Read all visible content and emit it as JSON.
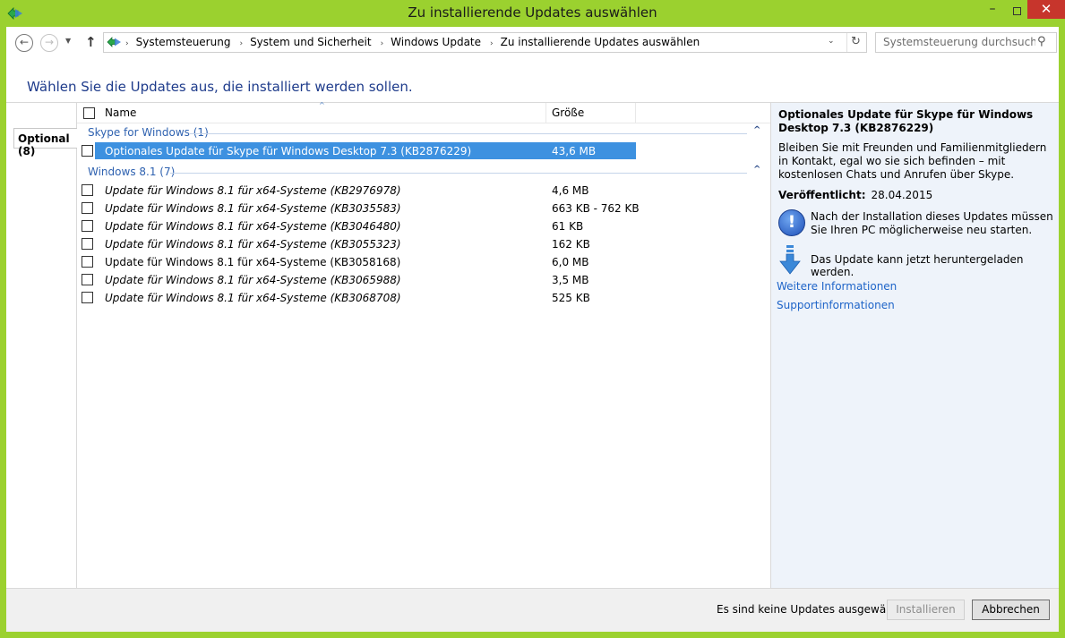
{
  "window": {
    "title": "Zu installierende Updates auswählen",
    "minimize": "–",
    "close": "✕"
  },
  "nav": {
    "back": "←",
    "forward": "→",
    "dropdown": "▼",
    "up": "↑",
    "breadcrumbs": [
      "Systemsteuerung",
      "System und Sicherheit",
      "Windows Update",
      "Zu installierende Updates auswählen"
    ],
    "breadcrumb_separator": "›",
    "search_placeholder": "Systemsteuerung durchsuchen"
  },
  "heading": "Wählen Sie die Updates aus, die installiert werden sollen.",
  "tabs": {
    "optional": "Optional (8)"
  },
  "columns": {
    "name": "Name",
    "size": "Größe"
  },
  "groups": [
    {
      "label": "Skype for Windows (1)",
      "items": [
        {
          "name": "Optionales Update für Skype für Windows Desktop 7.3 (KB2876229)",
          "size": "43,6 MB",
          "selected": true,
          "italic": false
        }
      ]
    },
    {
      "label": "Windows 8.1 (7)",
      "items": [
        {
          "name": "Update für Windows 8.1 für x64-Systeme (KB2976978)",
          "size": "4,6 MB",
          "italic": true
        },
        {
          "name": "Update für Windows 8.1 für x64-Systeme (KB3035583)",
          "size": "663 KB - 762 KB",
          "italic": true
        },
        {
          "name": "Update für Windows 8.1 für x64-Systeme (KB3046480)",
          "size": "61 KB",
          "italic": true
        },
        {
          "name": "Update für Windows 8.1 für x64-Systeme (KB3055323)",
          "size": "162 KB",
          "italic": true
        },
        {
          "name": "Update für Windows 8.1 für x64-Systeme (KB3058168)",
          "size": "6,0 MB",
          "italic": false
        },
        {
          "name": "Update für Windows 8.1 für x64-Systeme (KB3065988)",
          "size": "3,5 MB",
          "italic": true
        },
        {
          "name": "Update für Windows 8.1 für x64-Systeme (KB3068708)",
          "size": "525 KB",
          "italic": true
        }
      ]
    }
  ],
  "details": {
    "title": "Optionales Update für Skype für Windows Desktop 7.3 (KB2876229)",
    "description": "Bleiben Sie mit Freunden und Familienmitgliedern in Kontakt, egal wo sie sich befinden – mit kostenlosen Chats und Anrufen über Skype.",
    "published_label": "Veröffentlicht:",
    "published_date": "28.04.2015",
    "restart_note": "Nach der Installation dieses Updates müssen Sie Ihren PC möglicherweise neu starten.",
    "download_note": "Das Update kann jetzt heruntergeladen werden.",
    "more_info_link": "Weitere Informationen",
    "support_link": "Supportinformationen"
  },
  "footer": {
    "status": "Es sind keine Updates ausgewählt.",
    "install_label": "Installieren",
    "cancel_label": "Abbrechen"
  },
  "colors": {
    "titlebar": "#9bd12f",
    "close_button": "#c7352c",
    "selection": "#3d91e0",
    "heading": "#1e3b8b",
    "group_label": "#2f62b0",
    "details_bg": "#eef3fa",
    "link": "#1e64c8"
  }
}
